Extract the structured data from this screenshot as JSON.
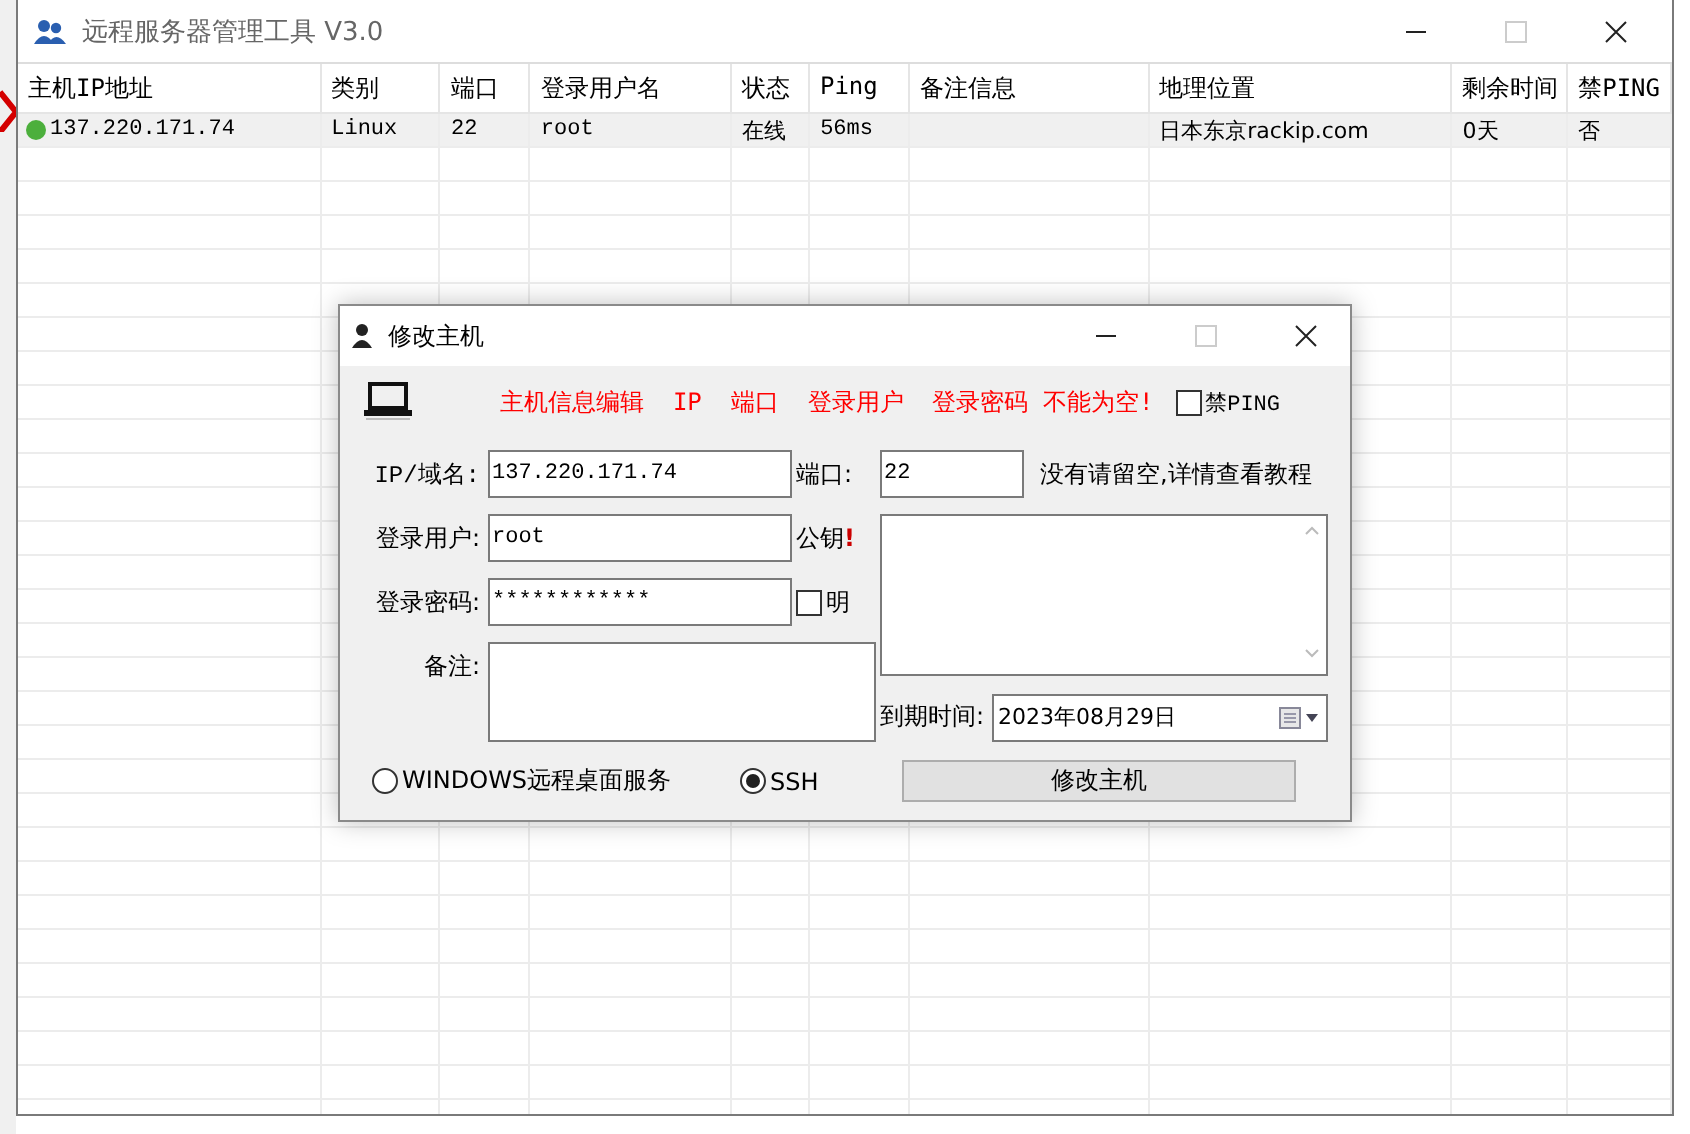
{
  "window": {
    "title": "远程服务器管理工具 V3.0"
  },
  "table": {
    "columns": [
      "主机IP地址",
      "类别",
      "端口",
      "登录用户名",
      "状态",
      "Ping",
      "备注信息",
      "地理位置",
      "剩余时间",
      "禁PING"
    ],
    "rows": [
      {
        "online": true,
        "selected": true,
        "cells": [
          "137.220.171.74",
          "Linux",
          "22",
          "root",
          "在线",
          "56ms",
          "",
          "日本东京rackip.com",
          "0天",
          "否"
        ]
      }
    ]
  },
  "dialog": {
    "title": "修改主机",
    "notice": "主机信息编辑  IP  端口  登录用户  登录密码 不能为空!",
    "no_ping": {
      "label": "禁PING",
      "checked": false
    },
    "ip_label": "IP/域名:",
    "ip_value": "137.220.171.74",
    "port_label": "端口:",
    "port_value": "22",
    "hint": "没有请留空,详情查看教程",
    "user_label": "登录用户:",
    "user_value": "root",
    "key_label": "公钥",
    "key_required": "!",
    "password_label": "登录密码:",
    "password_value": "************",
    "show_password": {
      "label": "明",
      "checked": false
    },
    "remark_label": "备注:",
    "expiry_label": "到期时间:",
    "expiry_value": "2023年08月29日",
    "modes": [
      {
        "label": "WINDOWS远程桌面服务",
        "selected": false
      },
      {
        "label": "SSH",
        "selected": true
      }
    ],
    "submit": "修改主机"
  }
}
